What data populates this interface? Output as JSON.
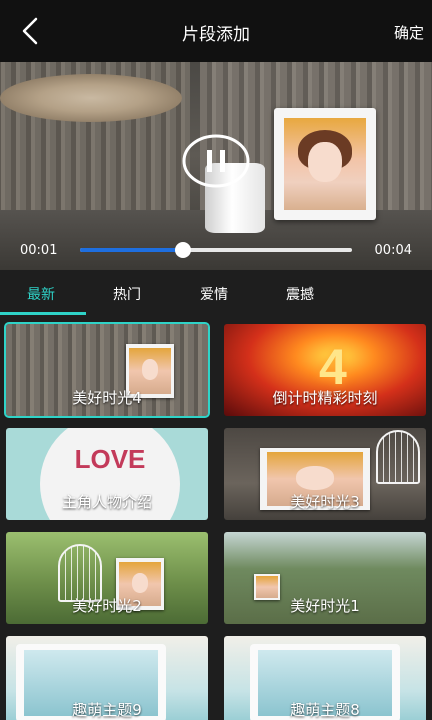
{
  "header": {
    "title": "片段添加",
    "confirm_label": "确定"
  },
  "player": {
    "current_time": "00:01",
    "total_time": "00:04",
    "progress_fraction": 0.38
  },
  "tabs": [
    {
      "label": "最新",
      "active": true
    },
    {
      "label": "热门",
      "active": false
    },
    {
      "label": "爱情",
      "active": false
    },
    {
      "label": "震撼",
      "active": false
    }
  ],
  "templates": [
    {
      "label": "美好时光4",
      "selected": true
    },
    {
      "label": "倒计时精彩时刻",
      "selected": false
    },
    {
      "label": "主角人物介绍",
      "selected": false
    },
    {
      "label": "美好时光3",
      "selected": false
    },
    {
      "label": "美好时光2",
      "selected": false
    },
    {
      "label": "美好时光1",
      "selected": false
    },
    {
      "label": "趣萌主题9",
      "selected": false
    },
    {
      "label": "趣萌主题8",
      "selected": false
    }
  ],
  "thumb_text": {
    "love": "LOVE",
    "countdown": "4"
  },
  "colors": {
    "accent": "#2fd3c8",
    "progress": "#1e6fe0",
    "header_bg": "#111111",
    "page_bg": "#1e1e1e"
  },
  "icons": {
    "back": "back-icon",
    "pause": "pause-icon"
  }
}
